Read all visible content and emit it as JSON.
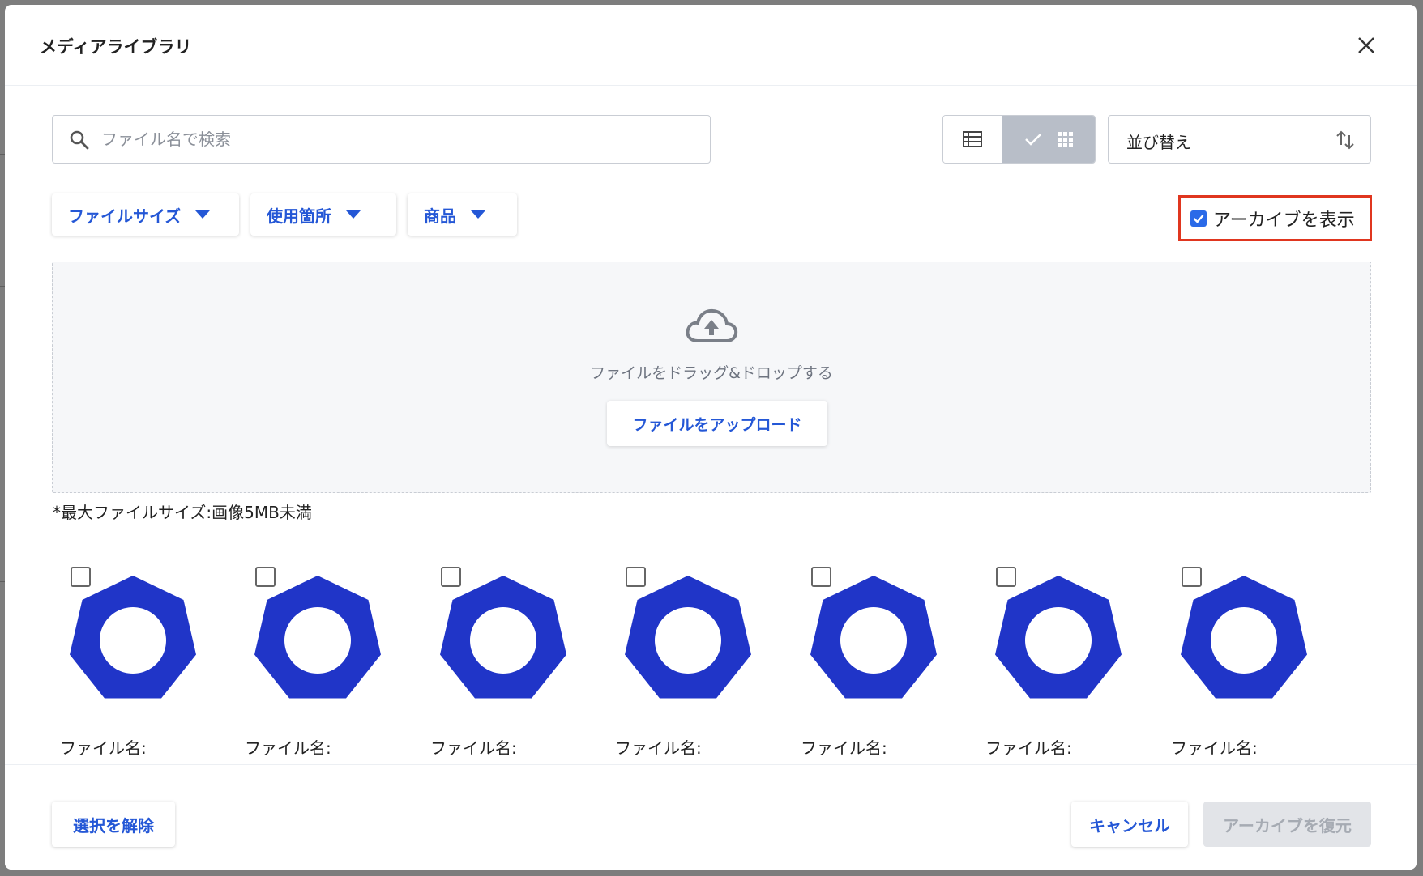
{
  "modal": {
    "title": "メディアライブラリ"
  },
  "toolbar": {
    "search_placeholder": "ファイル名で検索",
    "sort_label": "並び替え",
    "view_mode": "grid"
  },
  "filters": [
    {
      "label": "ファイルサイズ"
    },
    {
      "label": "使用箇所"
    },
    {
      "label": "商品"
    }
  ],
  "archive": {
    "label": "アーカイブを表示",
    "checked": true
  },
  "dropzone": {
    "text": "ファイルをドラッグ&ドロップする",
    "upload_label": "ファイルをアップロード"
  },
  "note": "*最大ファイルサイズ:画像5MB未満",
  "items": [
    {
      "name": "ファイル名:"
    },
    {
      "name": "ファイル名:"
    },
    {
      "name": "ファイル名:"
    },
    {
      "name": "ファイル名:"
    },
    {
      "name": "ファイル名:"
    },
    {
      "name": "ファイル名:"
    },
    {
      "name": "ファイル名:"
    }
  ],
  "footer": {
    "deselect_label": "選択を解除",
    "cancel_label": "キャンセル",
    "restore_label": "アーカイブを復元"
  },
  "colors": {
    "accent": "#2457d6",
    "thumbnail_fill": "#2035c8",
    "highlight_border": "#e0361f"
  }
}
